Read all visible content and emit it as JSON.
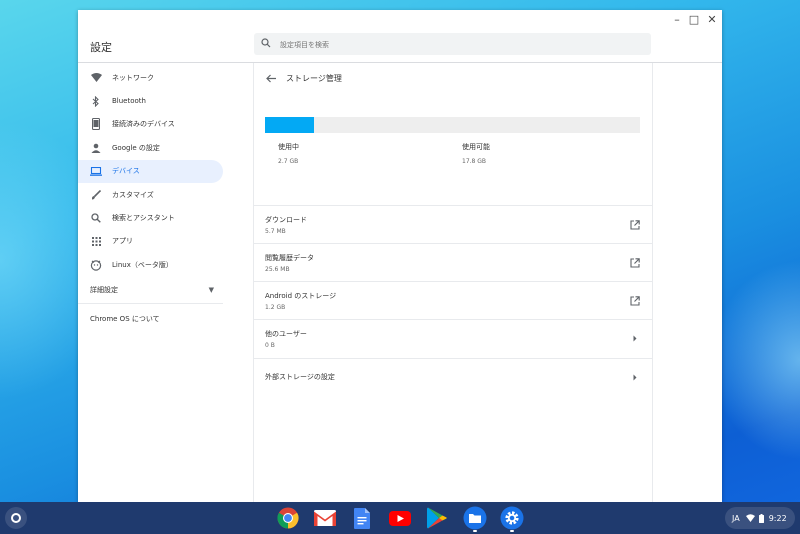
{
  "window": {
    "title": "設定",
    "controls": [
      "–",
      "□",
      "✕"
    ]
  },
  "search": {
    "placeholder": "設定項目を検索"
  },
  "sidebar": {
    "items": [
      {
        "label": "ネットワーク",
        "icon": "wifi-icon"
      },
      {
        "label": "Bluetooth",
        "icon": "bluetooth-icon"
      },
      {
        "label": "接続済みのデバイス",
        "icon": "phone-icon"
      },
      {
        "label": "Google の設定",
        "icon": "person-icon"
      },
      {
        "label": "デバイス",
        "icon": "laptop-icon",
        "active": true
      },
      {
        "label": "カスタマイズ",
        "icon": "brush-icon"
      },
      {
        "label": "検索とアシスタント",
        "icon": "search-icon"
      },
      {
        "label": "アプリ",
        "icon": "apps-grid-icon"
      },
      {
        "label": "Linux（ベータ版）",
        "icon": "linux-icon"
      }
    ],
    "advanced": "詳細設定",
    "about": "Chrome OS について"
  },
  "main": {
    "title": "ストレージ管理",
    "storage": {
      "used_fraction": 0.13,
      "used_label": "使用中",
      "used_value": "2.7 GB",
      "available_label": "使用可能",
      "available_value": "17.8 GB"
    },
    "rows": [
      {
        "title": "ダウンロード",
        "subtitle": "5.7 MB",
        "icon": "external-link-icon"
      },
      {
        "title": "閲覧履歴データ",
        "subtitle": "25.6 MB",
        "icon": "external-link-icon"
      },
      {
        "title": "Android のストレージ",
        "subtitle": "1.2 GB",
        "icon": "external-link-icon"
      },
      {
        "title": "他のユーザー",
        "subtitle": "0 B",
        "icon": "chevron-right-icon"
      },
      {
        "title": "外部ストレージの設定",
        "subtitle": "",
        "icon": "chevron-right-icon"
      }
    ]
  },
  "shelf": {
    "apps": [
      "chrome-icon",
      "gmail-icon",
      "docs-icon",
      "youtube-icon",
      "play-store-icon",
      "files-icon",
      "settings-icon"
    ],
    "tray": {
      "ime": "JA",
      "time": "9:22"
    }
  },
  "colors": {
    "accent": "#1a73e8",
    "storage_fill": "#03a9f4",
    "shelf": "#1f3a6e"
  }
}
